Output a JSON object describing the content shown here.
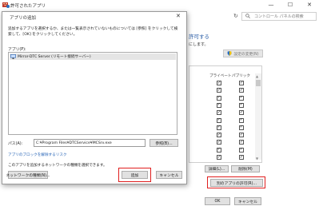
{
  "window": {
    "title": "許可されたアプリ",
    "controls": {
      "minimize": "—",
      "maximize": "☐",
      "close": "✕"
    }
  },
  "address": {
    "search_placeholder": "コントロール パネルの検索",
    "back": "←",
    "forward": "→",
    "up": "↑",
    "refresh": "↻"
  },
  "background_panel": {
    "heading_partial": "許可する",
    "subtext_partial": "にします。",
    "change_settings_label": "設定の変更(N)",
    "columns": {
      "private": "プライベート",
      "public": "パブリック"
    },
    "rows": [
      {
        "private": true,
        "public": true
      },
      {
        "private": true,
        "public": true
      },
      {
        "private": true,
        "public": true
      },
      {
        "private": true,
        "public": true
      },
      {
        "private": true,
        "public": true
      },
      {
        "private": true,
        "public": true
      },
      {
        "private": true,
        "public": true
      },
      {
        "private": true,
        "public": true
      },
      {
        "private": true,
        "public": true
      },
      {
        "private": true,
        "public": true
      },
      {
        "private": true,
        "public": true
      }
    ],
    "details_button": "詳細(L)...",
    "remove_button": "削除(M)",
    "allow_other_app_button": "別のアプリの許可(R)...",
    "ok_button": "OK",
    "cancel_button": "キャンセル"
  },
  "dialog": {
    "title": "アプリの追加",
    "close": "✕",
    "description": "追加するアプリを選択するか、または一覧表示されていないものについては [参照] をクリックして検索して、[OK] をクリックしてください。",
    "apps_label": "アプリ(P):",
    "apps": [
      {
        "name": "Mirror-DTC Server (リモート接続サーバー)"
      }
    ],
    "path_label": "パス(A):",
    "path_value": "C:¥Program Files¥DTCService¥MCSrv.exe",
    "browse_button": "参照(B)...",
    "unblock_link": "アプリのブロックを解除するリスク",
    "network_note": "このアプリを追加するネットワークの種類を選択できます。",
    "network_types_button": "ネットワークの種類(N)...",
    "add_button": "追加",
    "cancel_button": "キャンセル"
  },
  "colors": {
    "highlight_red": "#e01e1e",
    "link_blue": "#1f5fb4",
    "heading_blue": "#2b5ea7"
  }
}
